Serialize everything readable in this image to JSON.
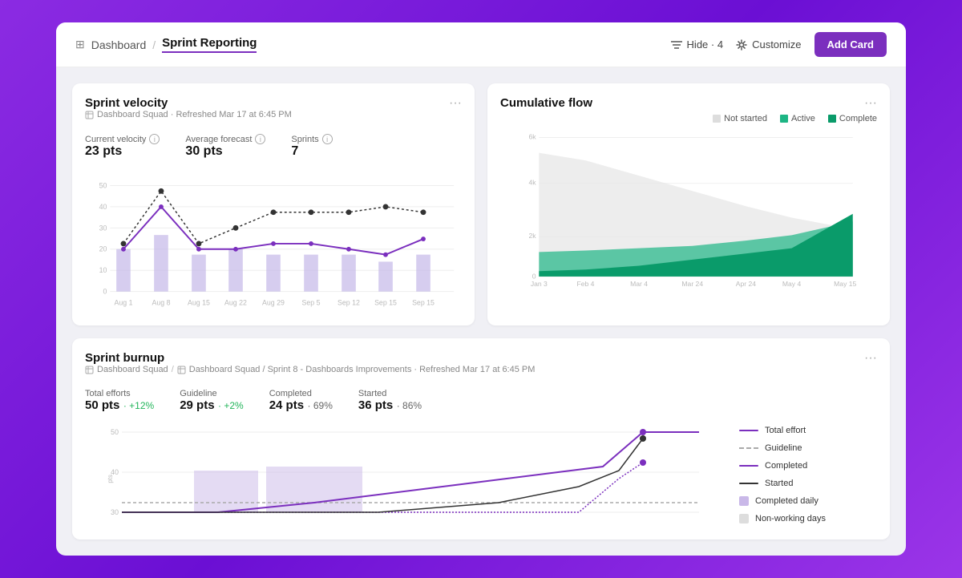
{
  "header": {
    "breadcrumb_home": "Dashboard",
    "breadcrumb_sep": "/",
    "breadcrumb_current": "Sprint Reporting",
    "dashboard_icon": "⊞",
    "hide_btn": "Hide · 4",
    "customize_btn": "Customize",
    "add_card_btn": "Add Card"
  },
  "sprint_velocity": {
    "title": "Sprint velocity",
    "subtitle": "Dashboard Squad · Refreshed Mar 17 at 6:45 PM",
    "current_velocity_label": "Current velocity",
    "current_velocity_value": "23 pts",
    "avg_forecast_label": "Average forecast",
    "avg_forecast_value": "30 pts",
    "sprints_label": "Sprints",
    "sprints_value": "7",
    "x_labels": [
      "Aug 1",
      "Aug 8",
      "Aug 15",
      "Aug 22",
      "Aug 29",
      "Sep 5",
      "Sep 12",
      "Sep 15",
      "Sep 15"
    ],
    "y_labels": [
      "0",
      "10",
      "20",
      "30",
      "40",
      "50"
    ]
  },
  "cumulative_flow": {
    "title": "Cumulative flow",
    "legend": [
      {
        "label": "Not started",
        "color": "#ddd"
      },
      {
        "label": "Active",
        "color": "#1DB584"
      },
      {
        "label": "Complete",
        "color": "#0A9B6A"
      }
    ],
    "y_labels": [
      "0",
      "2k",
      "4k",
      "6k"
    ],
    "x_labels": [
      "Jan 3",
      "Feb 4",
      "Mar 4",
      "Mar 24",
      "Apr 24",
      "May 4",
      "May 15"
    ]
  },
  "sprint_burnup": {
    "title": "Sprint burnup",
    "subtitle": "Dashboard Squad / Sprint 8 - Dashboards Improvements · Refreshed Mar 17 at 6:45 PM",
    "total_efforts_label": "Total efforts",
    "total_efforts_value": "50 pts",
    "total_efforts_change": "+12%",
    "guideline_label": "Guideline",
    "guideline_value": "29 pts",
    "guideline_change": "+2%",
    "completed_label": "Completed",
    "completed_value": "24 pts",
    "completed_pct": "69%",
    "started_label": "Started",
    "started_value": "36 pts",
    "started_pct": "86%",
    "legend": [
      {
        "label": "Total effort",
        "type": "solid",
        "color": "#7B2FBE"
      },
      {
        "label": "Guideline",
        "type": "dashed",
        "color": "#aaa"
      },
      {
        "label": "Completed",
        "type": "solid",
        "color": "#7B2FBE"
      },
      {
        "label": "Started",
        "type": "solid",
        "color": "#333"
      },
      {
        "label": "Completed daily",
        "type": "box",
        "color": "#c9b8e8"
      },
      {
        "label": "Non-working days",
        "type": "box",
        "color": "#ddd"
      }
    ],
    "y_labels": [
      "30",
      "40",
      "50"
    ],
    "chart_y_label": "pts"
  }
}
